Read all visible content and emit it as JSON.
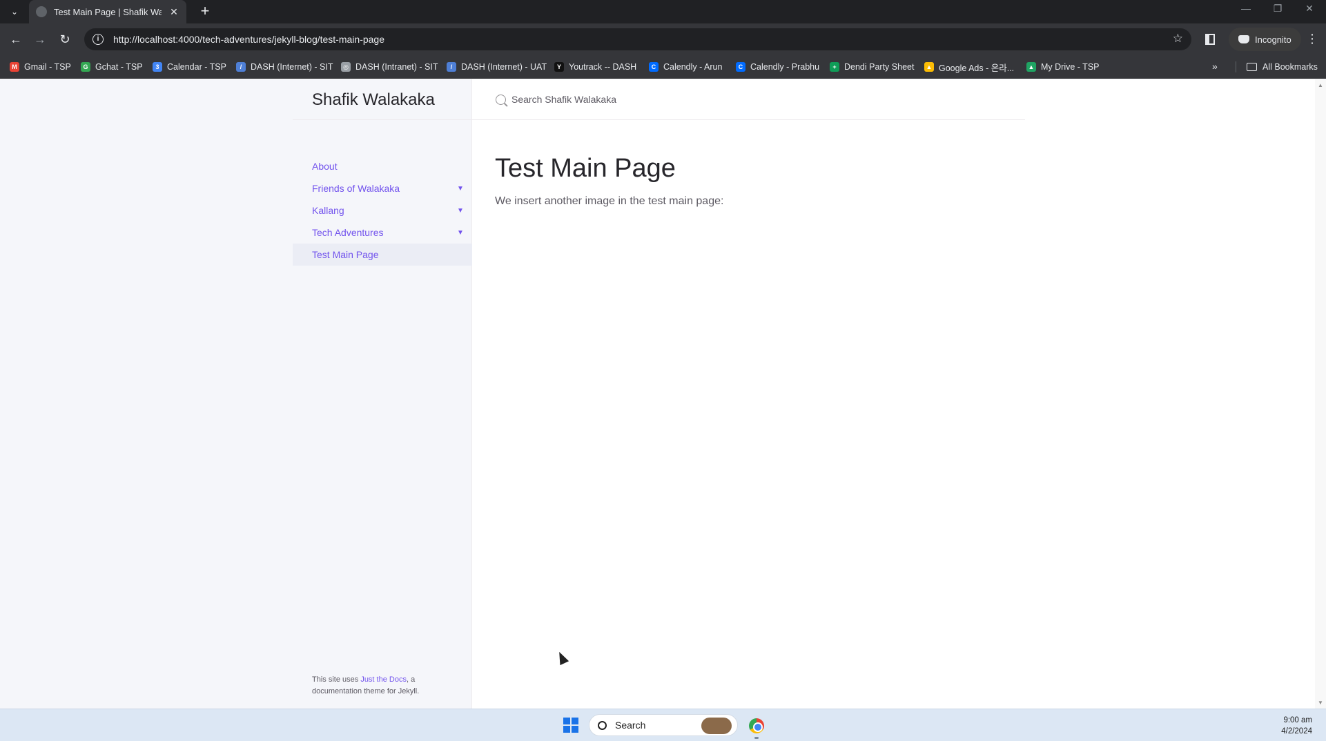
{
  "browser": {
    "tab_title": "Test Main Page | Shafik Walakaka",
    "url": "http://localhost:4000/tech-adventures/jekyll-blog/test-main-page",
    "profile_label": "Incognito",
    "bookmarks": [
      {
        "label": "Gmail - TSP",
        "color": "#ea4335",
        "glyph": "M"
      },
      {
        "label": "Gchat - TSP",
        "color": "#34a853",
        "glyph": "G"
      },
      {
        "label": "Calendar - TSP",
        "color": "#4285f4",
        "glyph": "3"
      },
      {
        "label": "DASH (Internet) - SIT",
        "color": "#4e7fd6",
        "glyph": "/"
      },
      {
        "label": "DASH (Intranet) - SIT",
        "color": "#9aa0a6",
        "glyph": "◎"
      },
      {
        "label": "DASH (Internet) - UAT",
        "color": "#4e7fd6",
        "glyph": "/"
      },
      {
        "label": "Youtrack -- DASH",
        "color": "#111111",
        "glyph": "Y"
      },
      {
        "label": "Calendly - Arun",
        "color": "#006bff",
        "glyph": "C"
      },
      {
        "label": "Calendly - Prabhu",
        "color": "#006bff",
        "glyph": "C"
      },
      {
        "label": "Dendi Party Sheet",
        "color": "#0f9d58",
        "glyph": "+"
      },
      {
        "label": "Google Ads - 온라...",
        "color": "#fbbc04",
        "glyph": "▲"
      },
      {
        "label": "My Drive - TSP",
        "color": "#1fa463",
        "glyph": "▲"
      }
    ],
    "all_bookmarks_label": "All Bookmarks"
  },
  "site": {
    "title": "Shafik Walakaka",
    "search_placeholder": "Search Shafik Walakaka",
    "nav": [
      {
        "label": "About",
        "expandable": false,
        "active": false
      },
      {
        "label": "Friends of Walakaka",
        "expandable": true,
        "active": false
      },
      {
        "label": "Kallang",
        "expandable": true,
        "active": false
      },
      {
        "label": "Tech Adventures",
        "expandable": true,
        "active": false
      },
      {
        "label": "Test Main Page",
        "expandable": false,
        "active": true
      }
    ],
    "footer": {
      "prefix": "This site uses ",
      "link": "Just the Docs",
      "suffix": ", a documentation theme for Jekyll."
    }
  },
  "page": {
    "heading": "Test Main Page",
    "body": "We insert another image in the test main page:"
  },
  "taskbar": {
    "search_label": "Search",
    "time": "9:00 am",
    "date": "4/2/2024"
  },
  "colors": {
    "link": "#7253ed",
    "text": "#5c5962",
    "heading": "#27262b",
    "sidebar_bg": "#f5f6fa"
  }
}
